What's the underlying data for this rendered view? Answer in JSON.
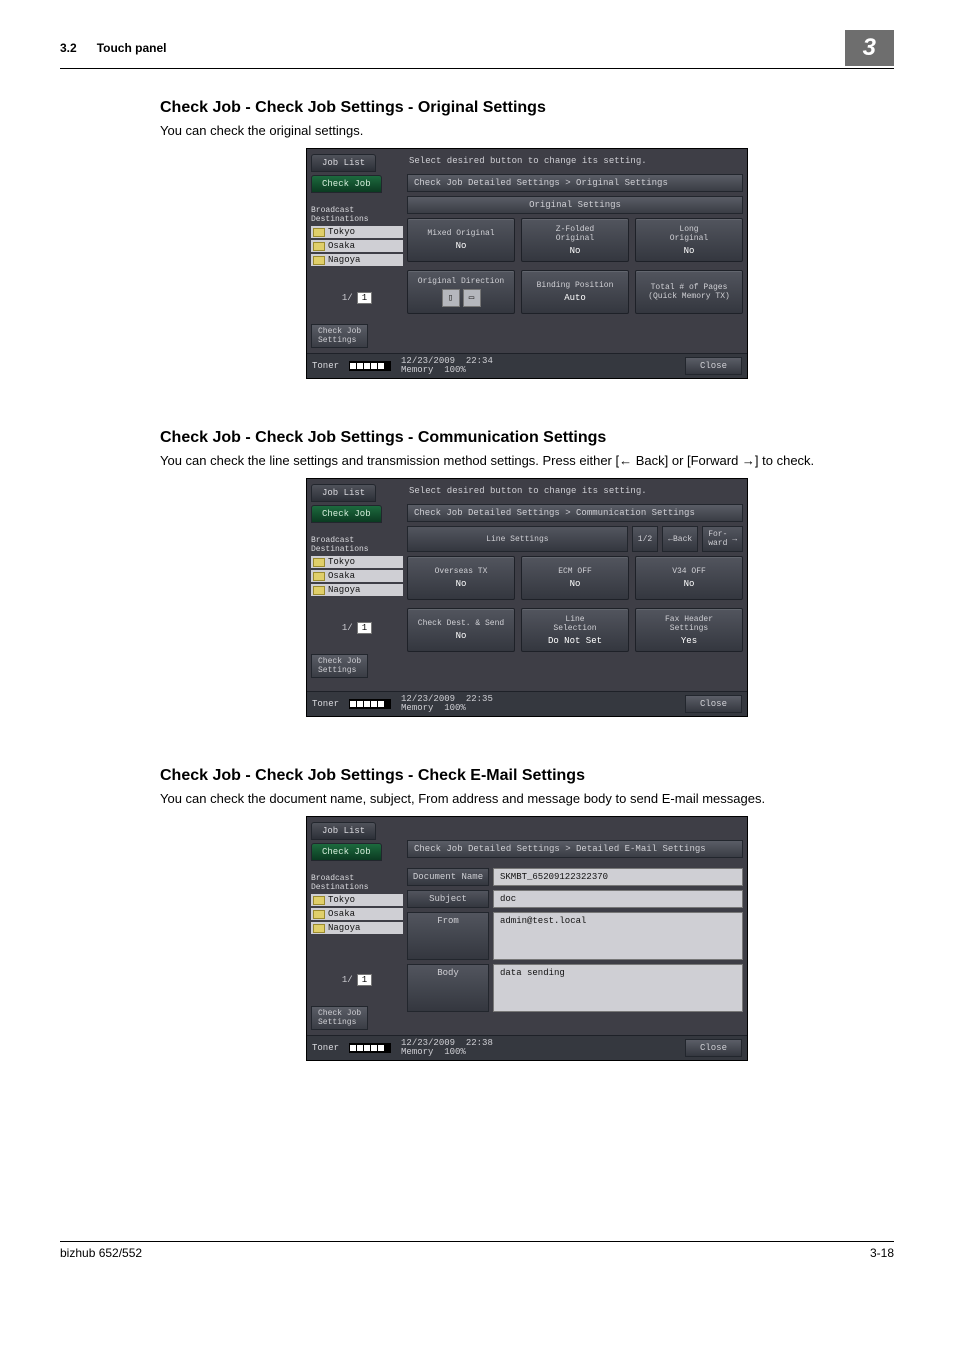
{
  "header": {
    "section_num": "3.2",
    "section_title": "Touch panel",
    "chapter_badge": "3"
  },
  "sections": {
    "s1": {
      "title": "Check Job - Check Job Settings - Original Settings",
      "body": "You can check the original settings."
    },
    "s2": {
      "title": "Check Job - Check Job Settings - Communication Settings",
      "body": "You can check the line settings and transmission method settings. Press either [← Back] or [Forward →] to check."
    },
    "s3": {
      "title": "Check Job - Check Job Settings - Check E-Mail Settings",
      "body": "You can check the document name, subject, From address and message body to send E-mail messages."
    }
  },
  "panel_common": {
    "job_list": "Job List",
    "check_job": "Check Job",
    "broadcast": "Broadcast\nDestinations",
    "dests": [
      "Tokyo",
      "Osaka",
      "Nagoya"
    ],
    "pager_cur": "1/",
    "pager_total": "1",
    "check_job_settings": "Check Job\nSettings",
    "toner_label": "Toner",
    "close": "Close"
  },
  "panel1": {
    "prompt": "Select desired button to change its setting.",
    "breadcrumb": "Check Job Detailed Settings > Original Settings",
    "cat": "Original Settings",
    "tiles1": [
      {
        "label": "Mixed Original",
        "value": "No"
      },
      {
        "label": "Z-Folded\nOriginal",
        "value": "No"
      },
      {
        "label": "Long\nOriginal",
        "value": "No"
      }
    ],
    "tiles2": [
      {
        "label": "Original Direction",
        "value": ""
      },
      {
        "label": "Binding Position",
        "value": "Auto"
      },
      {
        "label": "Total # of Pages\n(Quick Memory TX)",
        "value": ""
      }
    ],
    "datetime": "12/23/2009",
    "time": "22:34",
    "memory": "Memory",
    "mempct": "100%"
  },
  "panel2": {
    "prompt": "Select desired button to change its setting.",
    "breadcrumb": "Check Job Detailed Settings > Communication Settings",
    "cat": "Line Settings",
    "page_ind": "1/2",
    "back": "Back",
    "fwd": "For-\nward",
    "tiles1": [
      {
        "label": "Overseas TX",
        "value": "No"
      },
      {
        "label": "ECM OFF",
        "value": "No"
      },
      {
        "label": "V34 OFF",
        "value": "No"
      }
    ],
    "tiles2": [
      {
        "label": "Check Dest. & Send",
        "value": "No"
      },
      {
        "label": "Line\nSelection",
        "value": "Do Not Set"
      },
      {
        "label": "Fax Header\nSettings",
        "value": "Yes"
      }
    ],
    "datetime": "12/23/2009",
    "time": "22:35",
    "memory": "Memory",
    "mempct": "100%"
  },
  "panel3": {
    "breadcrumb": "Check Job Detailed Settings > Detailed E-Mail Settings",
    "kv": {
      "docname_k": "Document Name",
      "docname_v": "SKMBT_65209122322370",
      "subject_k": "Subject",
      "subject_v": "doc",
      "from_k": "From",
      "from_v": "admin@test.local",
      "body_k": "Body",
      "body_v": "data sending"
    },
    "datetime": "12/23/2009",
    "time": "22:38",
    "memory": "Memory",
    "mempct": "100%"
  },
  "footer": {
    "left": "bizhub 652/552",
    "right": "3-18"
  }
}
